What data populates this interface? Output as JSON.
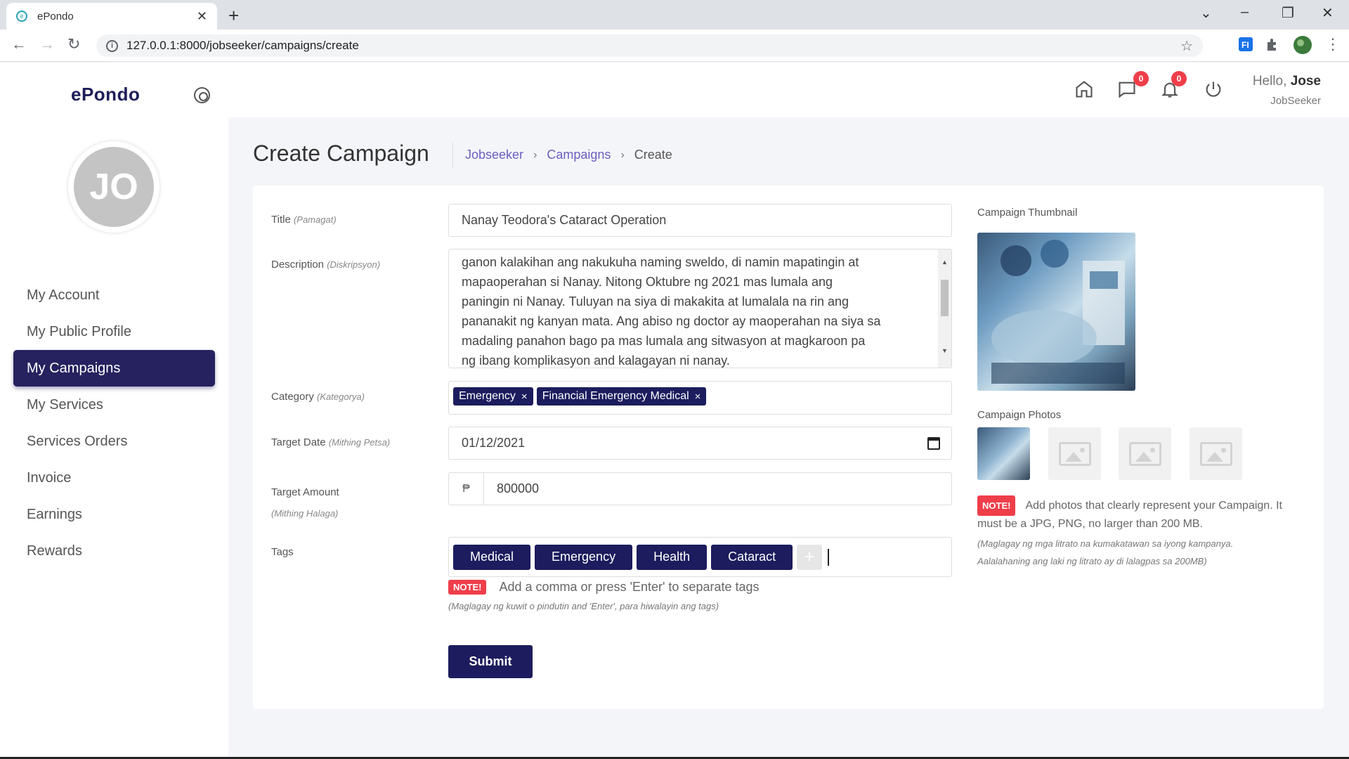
{
  "browser": {
    "tab_title": "ePondo",
    "url": "127.0.0.1:8000/jobseeker/campaigns/create"
  },
  "sidebar": {
    "brand": "ePondo",
    "avatar_initials": "JO",
    "items": [
      {
        "label": "My Account"
      },
      {
        "label": "My Public Profile"
      },
      {
        "label": "My Campaigns"
      },
      {
        "label": "My Services"
      },
      {
        "label": "Services Orders"
      },
      {
        "label": "Invoice"
      },
      {
        "label": "Earnings"
      },
      {
        "label": "Rewards"
      }
    ]
  },
  "header": {
    "messages_count": "0",
    "notifications_count": "0",
    "greeting": "Hello,",
    "user_name": "Jose",
    "user_role": "JobSeeker"
  },
  "page": {
    "title": "Create Campaign",
    "breadcrumb": [
      "Jobseeker",
      "Campaigns",
      "Create"
    ]
  },
  "form": {
    "title_label": "Title",
    "title_hint": "(Pamagat)",
    "title_value": "Nanay Teodora's Cataract Operation",
    "description_label": "Description",
    "description_hint": "(Diskripsyon)",
    "description_lines": [
      "ganon kalakihan ang nakukuha naming sweldo, di namin mapatingin at",
      "mapaoperahan si Nanay. Nitong Oktubre ng 2021 mas lumala ang",
      "paningin ni Nanay. Tuluyan na siya di makakita at lumalala na rin ang",
      "pananakit ng kanyan mata. Ang abiso ng doctor ay maoperahan na siya sa",
      "madaling panahon bago pa mas lumala ang sitwasyon at magkaroon pa",
      "ng ibang komplikasyon and kalagayan ni nanay."
    ],
    "category_label": "Category",
    "category_hint": "(Kategorya)",
    "categories": [
      "Emergency",
      "Financial Emergency Medical"
    ],
    "target_date_label": "Target Date",
    "target_date_hint": "(Mithing Petsa)",
    "target_date_value": "01/12/2021",
    "target_amount_label": "Target Amount",
    "target_amount_hint": "(Mithing Halaga)",
    "currency_symbol": "₱",
    "target_amount_value": "800000",
    "tags_label": "Tags",
    "tags": [
      "Medical",
      "Emergency",
      "Health",
      "Cataract"
    ],
    "tags_add": "+",
    "note_badge": "NOTE!",
    "tags_note": "Add a comma or press 'Enter' to separate tags",
    "tags_note_sub": "(Maglagay ng kuwit o pindutin and 'Enter', para hiwalayin ang tags)",
    "submit_label": "Submit"
  },
  "side": {
    "thumbnail_label": "Campaign Thumbnail",
    "photos_label": "Campaign Photos",
    "note_badge": "NOTE!",
    "photos_note": "Add photos that clearly represent your Campaign. It must be a JPG, PNG, no larger than 200 MB.",
    "photos_note_sub_1": "(Maglagay ng mga litrato na kumakatawan sa iyong kampanya.",
    "photos_note_sub_2": "Aalalahaning ang laki ng litrato ay di lalagpas sa 200MB)"
  },
  "colors": {
    "primary": "#1c1c5e",
    "active_menu": "#26225f",
    "badge": "#ef3e4a",
    "link": "#6a5fc1"
  },
  "icons": {
    "home": "home-icon",
    "messages": "chat-icon",
    "notifications": "bell-icon",
    "logout": "power-icon"
  }
}
